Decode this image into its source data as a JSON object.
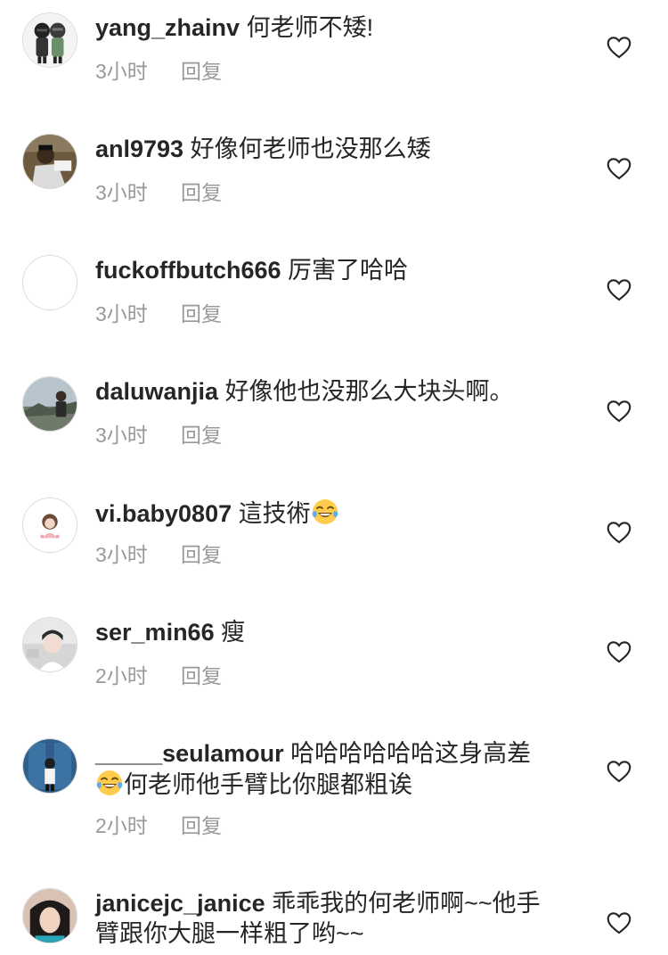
{
  "comments": [
    {
      "username": "yang_zhainv",
      "text": "何老师不矮!",
      "time": "3小时",
      "reply": "回复",
      "avatar": "cartoon-couple-avatar",
      "liked": false
    },
    {
      "username": "anl9793",
      "text": "好像何老师也没那么矮",
      "time": "3小时",
      "reply": "回复",
      "avatar": "photo-avatar",
      "liked": false
    },
    {
      "username": "fuckoffbutch666",
      "text": "厉害了哈哈",
      "time": "3小时",
      "reply": "回复",
      "avatar": "empty-avatar",
      "liked": false
    },
    {
      "username": "daluwanjia",
      "text": "好像他也没那么大块头啊。",
      "time": "3小时",
      "reply": "回复",
      "avatar": "outdoor-photo-avatar",
      "liked": false
    },
    {
      "username": "vi.baby0807",
      "text": "這技術",
      "text_emoji": "tears-of-joy-emoji",
      "time": "3小时",
      "reply": "回复",
      "avatar": "girl-illustration-avatar",
      "liked": false
    },
    {
      "username": "ser_min66",
      "text": "瘦",
      "time": "2小时",
      "reply": "回复",
      "avatar": "portrait-photo-avatar",
      "liked": false
    },
    {
      "username": "_____seulamour",
      "text": "哈哈哈哈哈哈这身高差",
      "text_line2_emoji": "tears-of-joy-emoji",
      "text_line2": "何老师他手臂比你腿都粗诶",
      "time": "2小时",
      "reply": "回复",
      "avatar": "blue-door-photo-avatar",
      "liked": false
    },
    {
      "username": "janicejc_janice",
      "text": "乖乖我的何老师啊~~他手臂跟你大腿一样粗了哟~~",
      "time": "",
      "reply": "",
      "avatar": "selfie-photo-avatar",
      "liked": false
    }
  ],
  "colors": {
    "text": "#262626",
    "meta": "#999999",
    "border": "#dbdbdb",
    "heart_outline": "#262626"
  },
  "icons": {
    "like": "heart-outline-icon",
    "emoji": "face-with-tears-of-joy"
  }
}
